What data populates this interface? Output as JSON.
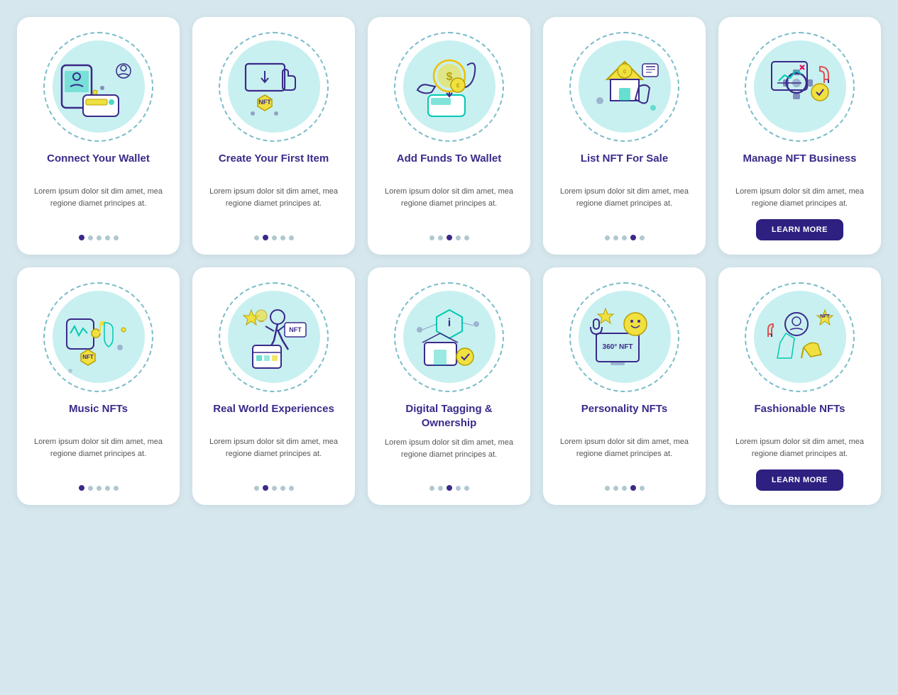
{
  "cards": [
    {
      "id": "connect-wallet",
      "title": "Connect Your Wallet",
      "body": "Lorem ipsum dolor sit dim amet, mea regione diamet principes at.",
      "dots": [
        1,
        0,
        0,
        0,
        0
      ],
      "has_button": false,
      "button_label": ""
    },
    {
      "id": "create-first-item",
      "title": "Create Your First Item",
      "body": "Lorem ipsum dolor sit dim amet, mea regione diamet principes at.",
      "dots": [
        0,
        1,
        0,
        0,
        0
      ],
      "has_button": false,
      "button_label": ""
    },
    {
      "id": "add-funds",
      "title": "Add Funds To Wallet",
      "body": "Lorem ipsum dolor sit dim amet, mea regione diamet principes at.",
      "dots": [
        0,
        0,
        1,
        0,
        0
      ],
      "has_button": false,
      "button_label": ""
    },
    {
      "id": "list-nft",
      "title": "List NFT For Sale",
      "body": "Lorem ipsum dolor sit dim amet, mea regione diamet principes at.",
      "dots": [
        0,
        0,
        0,
        1,
        0
      ],
      "has_button": false,
      "button_label": ""
    },
    {
      "id": "manage-nft",
      "title": "Manage NFT Business",
      "body": "Lorem ipsum dolor sit dim amet, mea regione diamet principes at.",
      "dots": [
        0,
        0,
        0,
        0,
        1
      ],
      "has_button": true,
      "button_label": "LEARN MORE"
    },
    {
      "id": "music-nfts",
      "title": "Music NFTs",
      "body": "Lorem ipsum dolor sit dim amet, mea regione diamet principes at.",
      "dots": [
        1,
        0,
        0,
        0,
        0
      ],
      "has_button": false,
      "button_label": ""
    },
    {
      "id": "real-world",
      "title": "Real World Experiences",
      "body": "Lorem ipsum dolor sit dim amet, mea regione diamet principes at.",
      "dots": [
        0,
        1,
        0,
        0,
        0
      ],
      "has_button": false,
      "button_label": ""
    },
    {
      "id": "digital-tagging",
      "title": "Digital Tagging & Ownership",
      "body": "Lorem ipsum dolor sit dim amet, mea regione diamet principes at.",
      "dots": [
        0,
        0,
        1,
        0,
        0
      ],
      "has_button": false,
      "button_label": ""
    },
    {
      "id": "personality-nfts",
      "title": "Personality NFTs",
      "body": "Lorem ipsum dolor sit dim amet, mea regione diamet principes at.",
      "dots": [
        0,
        0,
        0,
        1,
        0
      ],
      "has_button": false,
      "button_label": ""
    },
    {
      "id": "fashionable-nfts",
      "title": "Fashionable NFTs",
      "body": "Lorem ipsum dolor sit dim amet, mea regione diamet principes at.",
      "dots": [
        0,
        0,
        0,
        0,
        1
      ],
      "has_button": true,
      "button_label": "LEARN MORE"
    }
  ]
}
